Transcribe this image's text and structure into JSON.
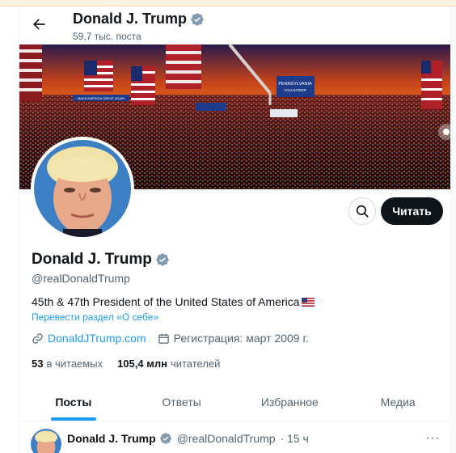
{
  "header": {
    "name": "Donald J. Trump",
    "post_count": "59,7 тыс. поста"
  },
  "banner": {
    "signs": [
      "PENNSYLVANIA",
      "VOLUNTEER",
      "MAKE AMERICA GREAT AGAIN"
    ]
  },
  "profile": {
    "name": "Donald J. Trump",
    "handle": "@realDonaldTrump",
    "bio": "45th & 47th President of the United States of America",
    "bio_flag": "us-flag-icon",
    "translate_label": "Перевести раздел «О себе»",
    "website": "DonaldJTrump.com",
    "joined": "Регистрация: март 2009 г.",
    "following_count": "53",
    "following_label": "в читаемых",
    "followers_count": "105,4 млн",
    "followers_label": "читателей",
    "follow_button": "Читать",
    "verified_color": "#829aab"
  },
  "tabs": [
    {
      "label": "Посты",
      "active": true
    },
    {
      "label": "Ответы",
      "active": false
    },
    {
      "label": "Избранное",
      "active": false
    },
    {
      "label": "Медиа",
      "active": false
    }
  ],
  "post": {
    "name": "Donald J. Trump",
    "handle": "@realDonaldTrump",
    "time": "· 15 ч",
    "more": "···"
  },
  "colors": {
    "accent": "#1d9bf0",
    "text": "#0f1419",
    "muted": "#536471"
  }
}
